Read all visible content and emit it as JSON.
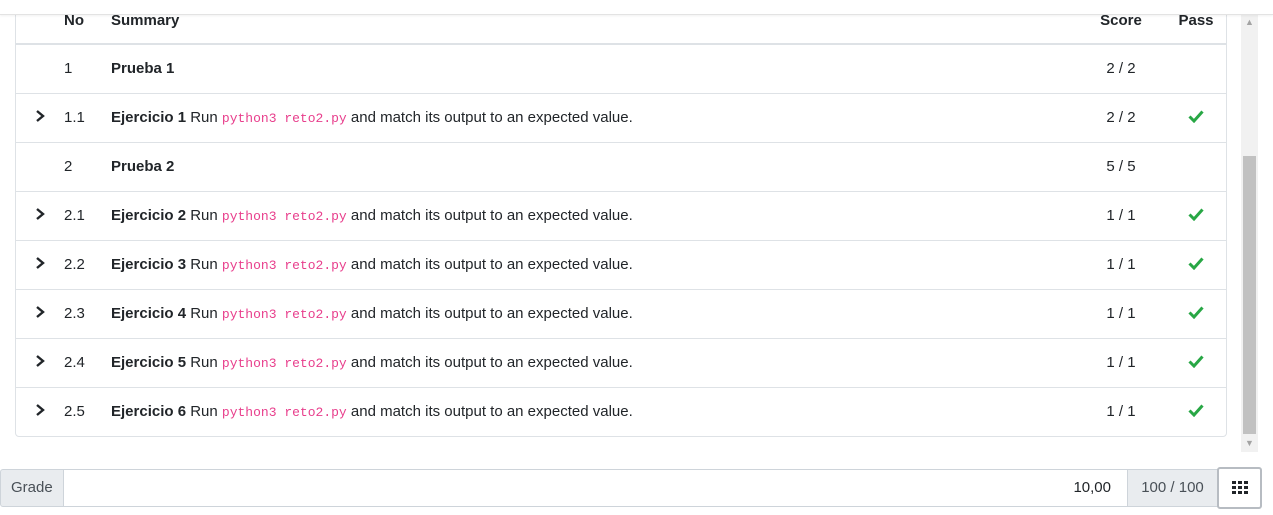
{
  "table": {
    "headers": {
      "no": "No",
      "summary": "Summary",
      "score": "Score",
      "pass": "Pass"
    },
    "rows": [
      {
        "no": "1",
        "name": "Prueba 1",
        "text_before": "",
        "code": "",
        "text_after": "",
        "score": "2 / 2",
        "expandable": false,
        "passed": false
      },
      {
        "no": "1.1",
        "name": "Ejercicio 1",
        "text_before": " Run ",
        "code": "python3 reto2.py",
        "text_after": " and match its output to an expected value.",
        "score": "2 / 2",
        "expandable": true,
        "passed": true
      },
      {
        "no": "2",
        "name": "Prueba 2",
        "text_before": "",
        "code": "",
        "text_after": "",
        "score": "5 / 5",
        "expandable": false,
        "passed": false
      },
      {
        "no": "2.1",
        "name": "Ejercicio 2",
        "text_before": " Run ",
        "code": "python3 reto2.py",
        "text_after": " and match its output to an expected value.",
        "score": "1 / 1",
        "expandable": true,
        "passed": true
      },
      {
        "no": "2.2",
        "name": "Ejercicio 3",
        "text_before": " Run ",
        "code": "python3 reto2.py",
        "text_after": " and match its output to an expected value.",
        "score": "1 / 1",
        "expandable": true,
        "passed": true
      },
      {
        "no": "2.3",
        "name": "Ejercicio 4",
        "text_before": " Run ",
        "code": "python3 reto2.py",
        "text_after": " and match its output to an expected value.",
        "score": "1 / 1",
        "expandable": true,
        "passed": true
      },
      {
        "no": "2.4",
        "name": "Ejercicio 5",
        "text_before": " Run ",
        "code": "python3 reto2.py",
        "text_after": " and match its output to an expected value.",
        "score": "1 / 1",
        "expandable": true,
        "passed": true
      },
      {
        "no": "2.5",
        "name": "Ejercicio 6",
        "text_before": " Run ",
        "code": "python3 reto2.py",
        "text_after": " and match its output to an expected value.",
        "score": "1 / 1",
        "expandable": true,
        "passed": true
      }
    ]
  },
  "grade": {
    "label": "Grade",
    "value": "10,00",
    "total": "100 / 100",
    "menu_icon": "grid-icon"
  },
  "icons": {
    "expand": "chevron-right-icon",
    "pass": "check-icon",
    "scroll_up": "caret-up-icon",
    "scroll_down": "caret-down-icon"
  },
  "colors": {
    "pass": "#28a745",
    "code": "#e83e8c",
    "border": "#dee2e6",
    "addon_bg": "#e9ecef"
  }
}
